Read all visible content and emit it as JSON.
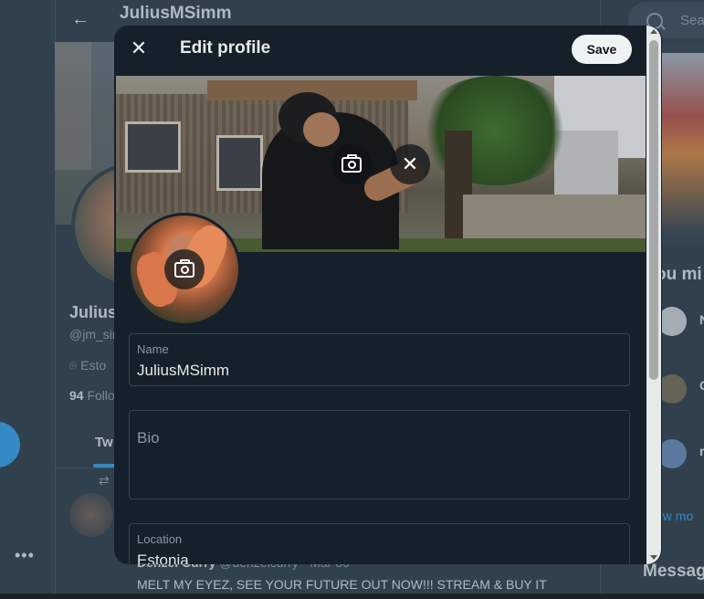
{
  "background": {
    "back_glyph": "←",
    "header_title": "JuliusMSimm",
    "profile_name": "Julius",
    "profile_handle": "@jm_sim",
    "location": "Esto",
    "following_count": "94",
    "following_label": "Follo",
    "tab_label": "Tw",
    "more_glyph": "•••",
    "tweet_author": "Denzel Curry",
    "tweet_meta": "@denzelcurry · Mar 30",
    "tweet_text": "MELT MY EYEZ, SEE YOUR FUTURE OUT NOW!!! STREAM & BUY IT",
    "search_placeholder": "Sea",
    "who_to_follow_title": "ou mi",
    "wtf_letters": [
      "N",
      "C",
      "r"
    ],
    "show_more": "ow mo",
    "messages_title": "Messag"
  },
  "modal": {
    "title": "Edit profile",
    "close_glyph": "✕",
    "save_label": "Save",
    "remove_glyph": "✕",
    "fields": {
      "name": {
        "label": "Name",
        "value": "JuliusMSimm"
      },
      "bio": {
        "placeholder": "Bio",
        "value": ""
      },
      "location": {
        "label": "Location",
        "value": "Estonia"
      }
    }
  },
  "colors": {
    "accent": "#1d9bf0",
    "background": "#15202b",
    "border": "#38444d"
  }
}
